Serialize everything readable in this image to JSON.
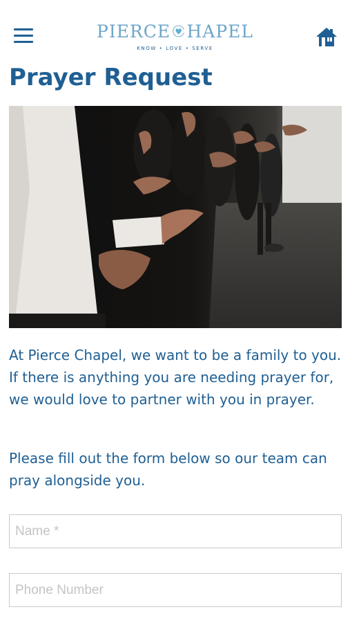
{
  "header": {
    "logo_text_left": "PIERCE",
    "logo_text_right": "HAPEL",
    "logo_tagline": "KNOW • LOVE • SERVE"
  },
  "page": {
    "title": "Prayer Request",
    "paragraph_1": "At Pierce Chapel, we want to be a family to you. If there is anything you are needing prayer for, we would love to partner with you in prayer.",
    "paragraph_2": "Please fill out the form below so our team can pray alongside you."
  },
  "form": {
    "name_placeholder": "Name *",
    "phone_placeholder": "Phone Number",
    "name_value": "",
    "phone_value": ""
  },
  "colors": {
    "primary": "#1f5f93",
    "logo_accent": "#6ea6c9",
    "field_border": "#c9c9c9"
  },
  "icons": {
    "menu": "hamburger-menu-icon",
    "home": "home-icon",
    "logo": "heart-c-logo-icon"
  }
}
